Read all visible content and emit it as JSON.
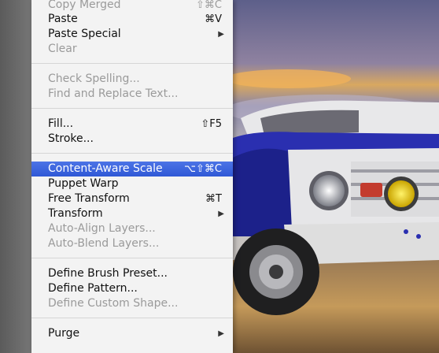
{
  "menu": {
    "items": [
      {
        "label": "Copy Merged",
        "shortcut": "⇧⌘C",
        "disabled": true
      },
      {
        "label": "Paste",
        "shortcut": "⌘V"
      },
      {
        "label": "Paste Special",
        "submenu": "▶"
      },
      {
        "label": "Clear",
        "disabled": true
      },
      {
        "label": "Check Spelling...",
        "disabled": true
      },
      {
        "label": "Find and Replace Text...",
        "disabled": true
      },
      {
        "label": "Fill...",
        "shortcut": "⇧F5"
      },
      {
        "label": "Stroke..."
      },
      {
        "label": "Content-Aware Scale",
        "shortcut": "⌥⇧⌘C",
        "highlighted": true
      },
      {
        "label": "Puppet Warp"
      },
      {
        "label": "Free Transform",
        "shortcut": "⌘T"
      },
      {
        "label": "Transform",
        "submenu": "▶"
      },
      {
        "label": "Auto-Align Layers...",
        "disabled": true
      },
      {
        "label": "Auto-Blend Layers...",
        "disabled": true
      },
      {
        "label": "Define Brush Preset..."
      },
      {
        "label": "Define Pattern..."
      },
      {
        "label": "Define Custom Shape...",
        "disabled": true
      },
      {
        "label": "Purge",
        "submenu": "▶"
      }
    ]
  },
  "colors": {
    "highlight": "#3a62dc",
    "menu_bg": "#f3f3f3",
    "disabled_text": "#9a9a9a",
    "truck_body": "#2a2fb0"
  }
}
